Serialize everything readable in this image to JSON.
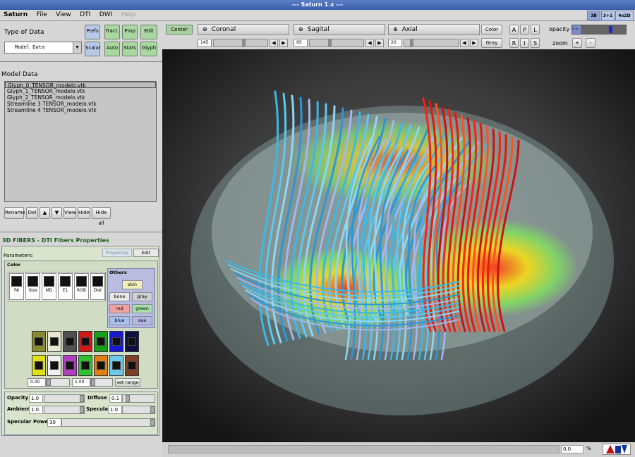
{
  "window": {
    "title": "--- Saturn 1.x ---"
  },
  "menu": {
    "items": [
      "Saturn",
      "File",
      "View",
      "DTI",
      "DWI",
      "Help"
    ]
  },
  "layout_buttons": [
    "3B",
    "3+1",
    "4x2D"
  ],
  "type_of_data": {
    "label": "Type of Data",
    "selected": "Model Data",
    "buttons": [
      "Prefs",
      "Tract.",
      "Prop",
      "Edit",
      "Scalar",
      "Auto",
      "Stats",
      "Glyph"
    ]
  },
  "model_data": {
    "label": "Model Data",
    "items": [
      "Glyph_0_TENSOR_modelo.vtk",
      "Glyph_1_TENSOR_modelo.vtk",
      "Glyph_2_TENSOR_modelo.vtk",
      "Streamline 3 TENSOR_modelo.vtk",
      "Streamline 4 TENSOR_modelo.vtk"
    ],
    "buttons": [
      "Rename",
      "Del",
      "▲",
      "▼",
      "View",
      "Hide",
      "Hide all"
    ]
  },
  "fibers": {
    "title": "3D FIBERS  - DTI Fibers Properties",
    "parameters_label": "Parameters:",
    "tabs": [
      "Properties",
      "Edit"
    ],
    "color_label": "Color",
    "color_modes": [
      "FA",
      "Size",
      "MD",
      "E1",
      "RGB",
      "Dist"
    ],
    "others_label": "Others",
    "others": [
      {
        "label": "skin",
        "color": "#f0f0b8"
      },
      {
        "label": "bone",
        "color": "#e8e8e8"
      },
      {
        "label": "gray",
        "color": "#d0d0d0"
      },
      {
        "label": "red",
        "color": "#f0a0a0"
      },
      {
        "label": "green",
        "color": "#a8e0a8"
      },
      {
        "label": "blue",
        "color": "#a8c0f0"
      },
      {
        "label": "sea",
        "color": "#b0b8e0"
      }
    ],
    "swatches_row1": [
      "#8a8a30",
      "#e8e8d0",
      "#505050",
      "#d01818",
      "#18a018",
      "#1818d0",
      "#101040"
    ],
    "swatches_row2": [
      "#e0e018",
      "#f0f0f0",
      "#b040c0",
      "#30c030",
      "#e08010",
      "#70c8e8",
      "#804028"
    ],
    "range_min": "0.00",
    "range_max": "1.00",
    "set_range": "set range",
    "opacity_label": "Opacity",
    "opacity_value": "1.0",
    "diffuse_label": "Diffuse",
    "diffuse_value": "0.1",
    "ambient_label": "Ambient",
    "ambient_value": "1.0",
    "specular_label": "Specular",
    "specular_value": "1.0",
    "specular_power_label": "Specular Power",
    "specular_power_value": "30"
  },
  "slices": {
    "center": "Center",
    "planes": [
      {
        "name": "Coronal",
        "value": "145"
      },
      {
        "name": "Sagital",
        "value": "95"
      },
      {
        "name": "Axial",
        "value": "20"
      }
    ],
    "color": "Color",
    "gray": "Gray",
    "orient": [
      "A",
      "P",
      "L",
      "R",
      "I",
      "S"
    ],
    "opacity_label": "opacity",
    "opacity_value": "0.0",
    "zoom_label": "zoom",
    "zoom_in": "+",
    "zoom_out": "-"
  },
  "status": {
    "progress": "0.0",
    "unit": "%"
  }
}
